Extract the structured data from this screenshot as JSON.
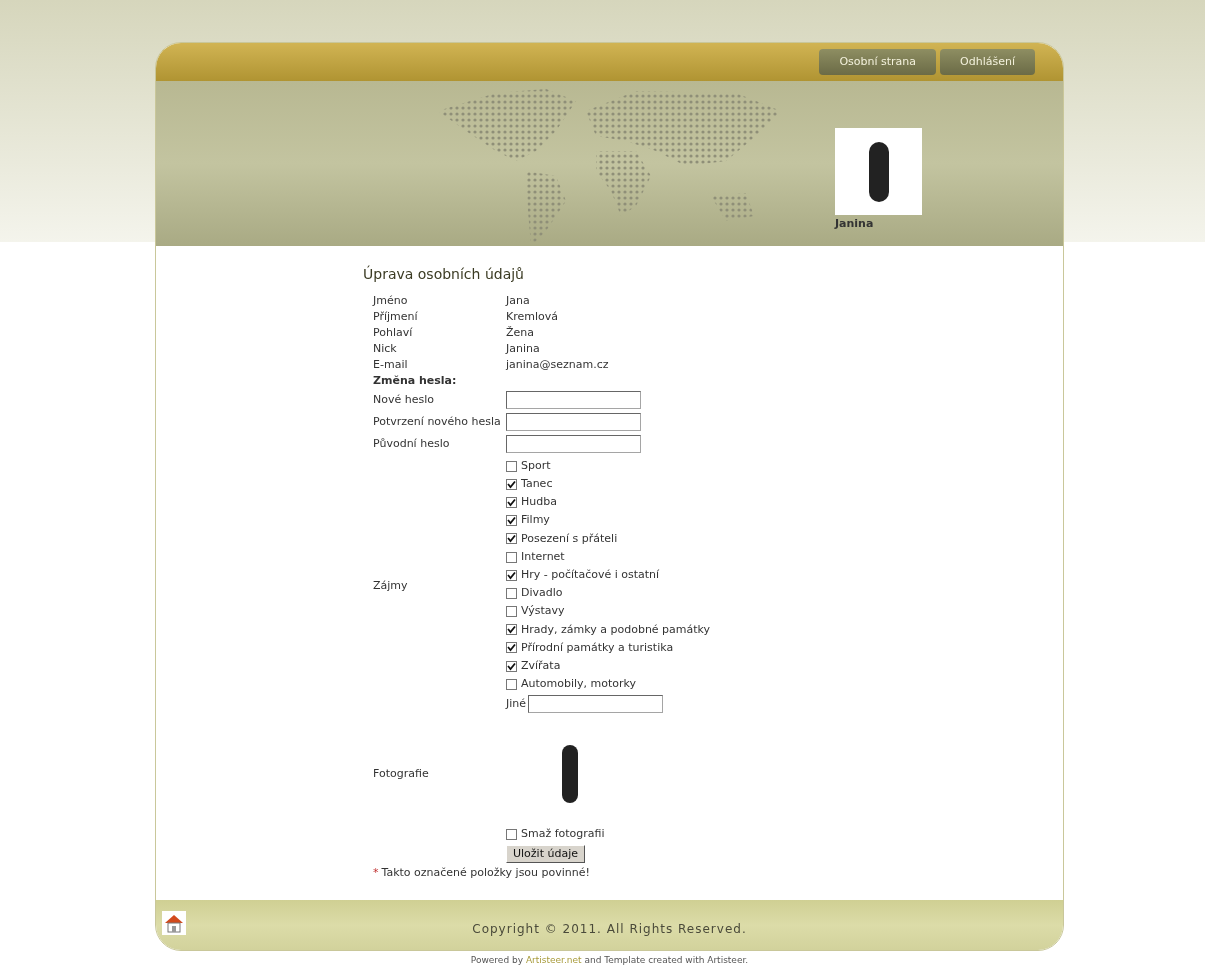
{
  "header": {
    "nav": [
      {
        "label": "Osobní strana"
      },
      {
        "label": "Odhlášení"
      }
    ],
    "user": {
      "name": "Janina"
    }
  },
  "form": {
    "title": "Úprava osobních údajů",
    "fields": [
      {
        "label": "Jméno",
        "value": "Jana"
      },
      {
        "label": "Příjmení",
        "value": "Kremlová"
      },
      {
        "label": "Pohlaví",
        "value": "Žena"
      },
      {
        "label": "Nick",
        "value": "Janina"
      },
      {
        "label": "E-mail",
        "value": "janina@seznam.cz"
      }
    ],
    "password_heading": "Změna hesla:",
    "password_fields": [
      {
        "label": "Nové heslo"
      },
      {
        "label": "Potvrzení nového hesla"
      },
      {
        "label": "Původní heslo"
      }
    ],
    "interests": {
      "label": "Zájmy",
      "options": [
        {
          "label": "Sport",
          "checked": false
        },
        {
          "label": "Tanec",
          "checked": true
        },
        {
          "label": "Hudba",
          "checked": true
        },
        {
          "label": "Filmy",
          "checked": true
        },
        {
          "label": "Posezení s přáteli",
          "checked": true
        },
        {
          "label": "Internet",
          "checked": false
        },
        {
          "label": "Hry - počítačové i ostatní",
          "checked": true
        },
        {
          "label": "Divadlo",
          "checked": false
        },
        {
          "label": "Výstavy",
          "checked": false
        },
        {
          "label": "Hrady, zámky a podobné památky",
          "checked": true
        },
        {
          "label": "Přírodní památky a turistika",
          "checked": true
        },
        {
          "label": "Zvířata",
          "checked": true
        },
        {
          "label": "Automobily, motorky",
          "checked": false
        }
      ],
      "other_label": "Jiné"
    },
    "photo": {
      "label": "Fotografie"
    },
    "delete_photo": {
      "label": "Smaž fotografii",
      "checked": false
    },
    "save_button": "Uložit údaje",
    "required_note": {
      "mark": "*",
      "text": "Takto označené položky jsou povinné!"
    }
  },
  "footer": {
    "copyright": "Copyright © 2011. All Rights Reserved."
  },
  "credit": {
    "before": "Powered by",
    "link": "Artisteer.net",
    "after": "and Template created with Artisteer."
  }
}
